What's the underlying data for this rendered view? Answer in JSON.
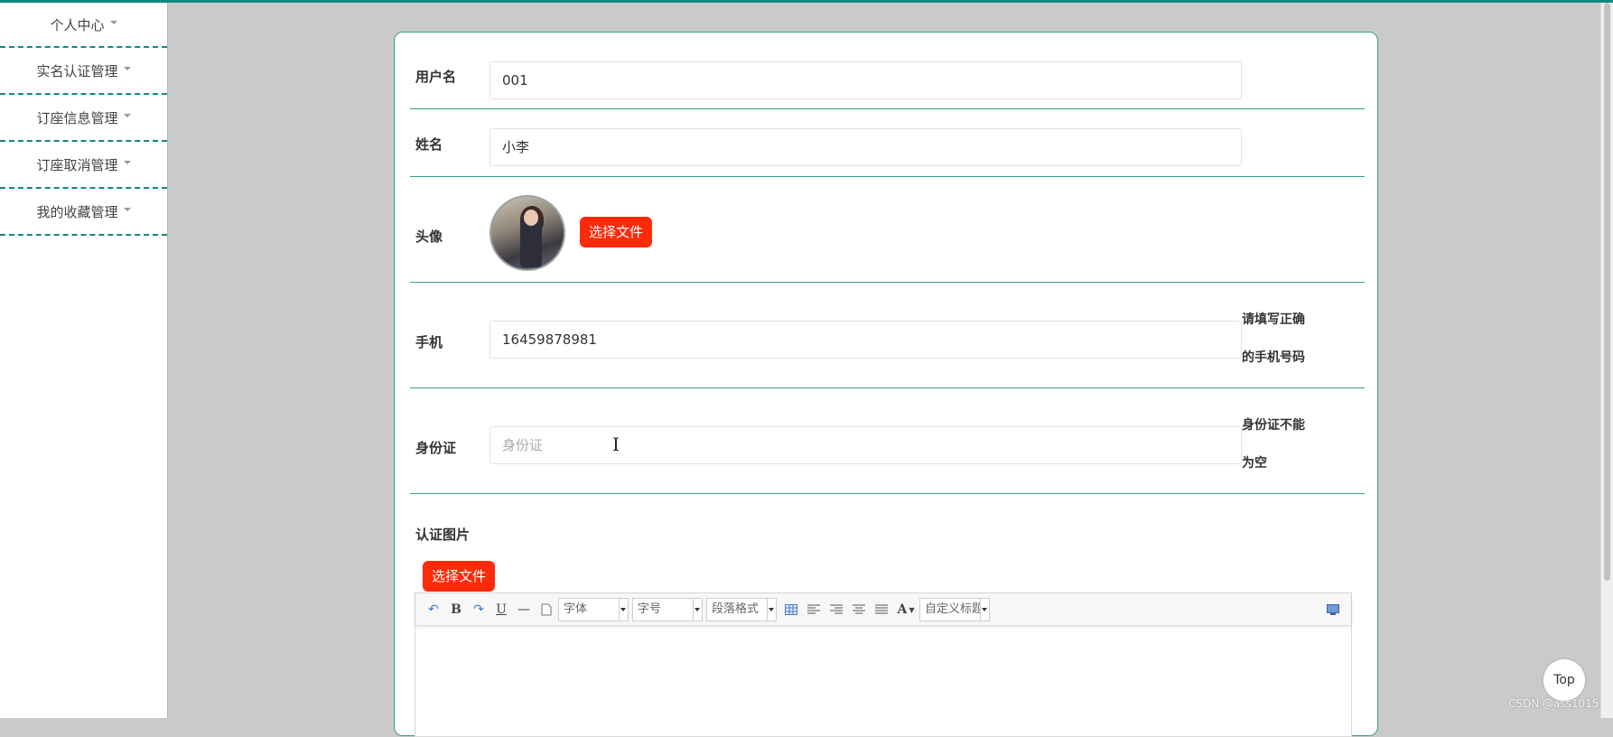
{
  "sidebar": {
    "items": [
      {
        "label": "个人中心"
      },
      {
        "label": "实名认证管理"
      },
      {
        "label": "订座信息管理"
      },
      {
        "label": "订座取消管理"
      },
      {
        "label": "我的收藏管理"
      }
    ]
  },
  "form": {
    "username": {
      "label": "用户名",
      "value": "001"
    },
    "name": {
      "label": "姓名",
      "value": "小李"
    },
    "avatar": {
      "label": "头像",
      "button": "选择文件"
    },
    "phone": {
      "label": "手机",
      "value": "16459878981",
      "hint_line1": "请填写正确",
      "hint_line2": "的手机号码"
    },
    "idcard": {
      "label": "身份证",
      "placeholder": "身份证",
      "hint_line1": "身份证不能",
      "hint_line2": "为空"
    },
    "cert_image": {
      "label": "认证图片",
      "button": "选择文件"
    }
  },
  "editor": {
    "font_select": "字体",
    "size_select": "字号",
    "paragraph_select": "段落格式",
    "custom_title_select": "自定义标题"
  },
  "top_button": "Top",
  "watermark": "CSDN @ass1015",
  "colors": {
    "accent": "#0f8a82",
    "button_red": "#ff2a0a",
    "border_green": "#36a08f"
  }
}
